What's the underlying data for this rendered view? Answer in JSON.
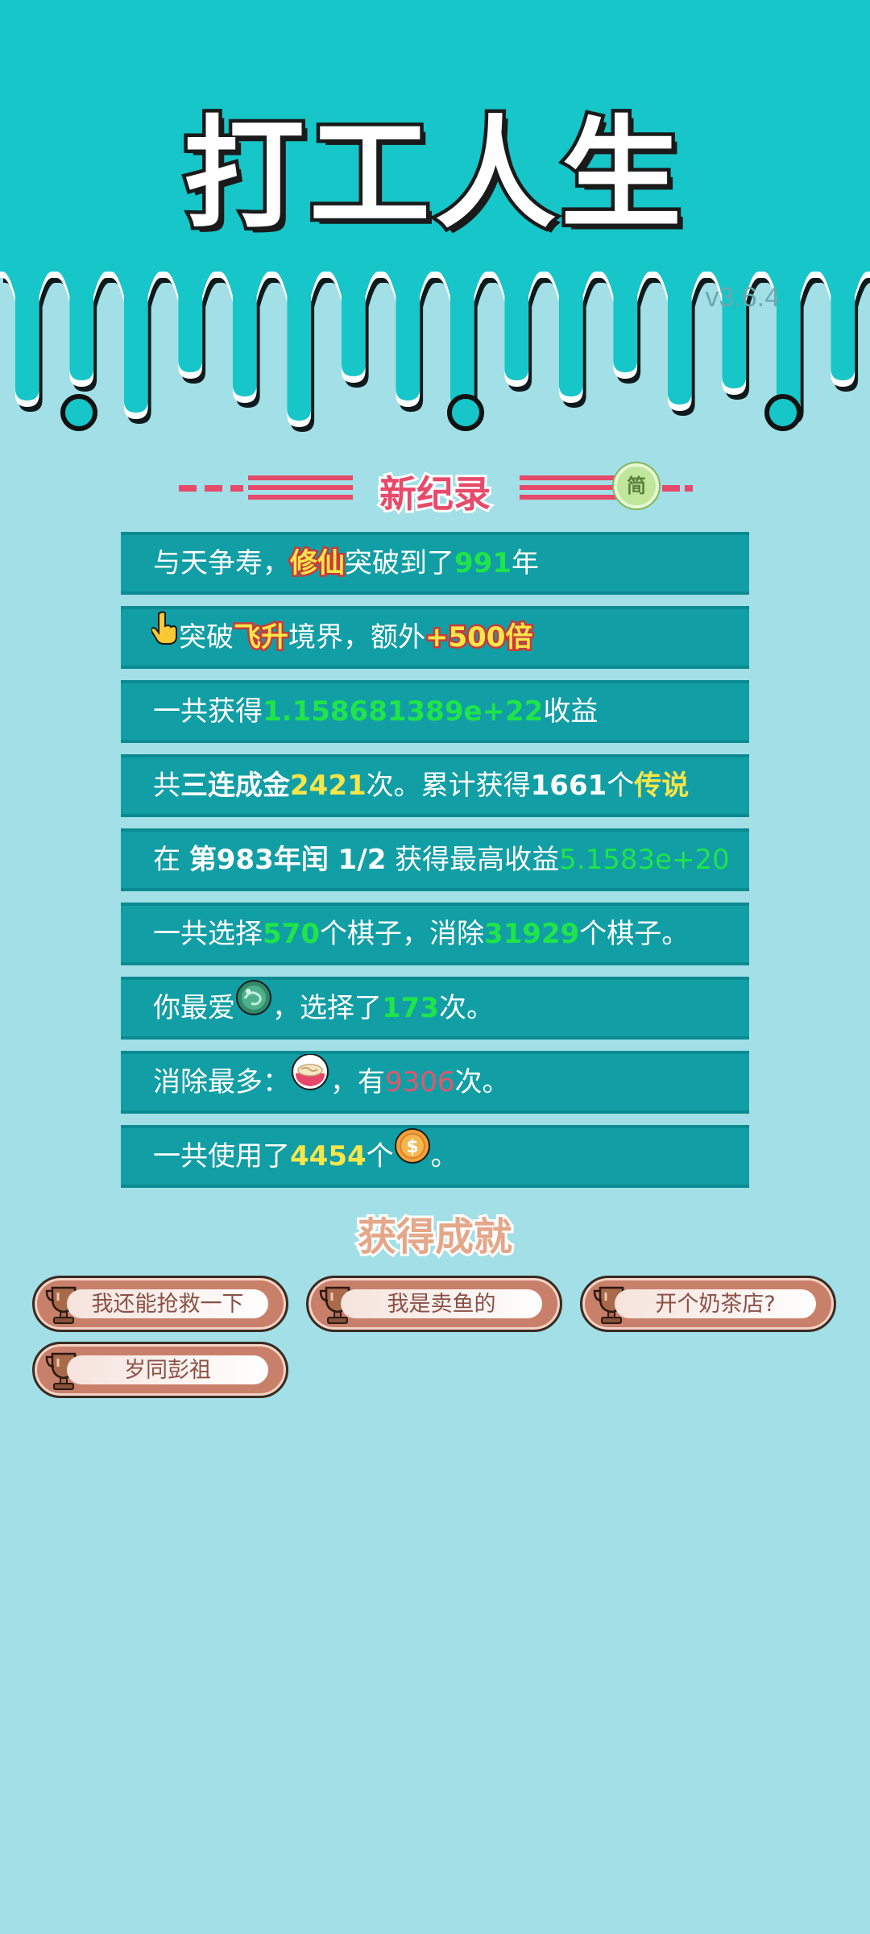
{
  "app": {
    "title": "打工人生",
    "version": "v3.6.4"
  },
  "record": {
    "title": "新纪录",
    "jian_label": "简"
  },
  "stats": {
    "row1": {
      "a": "与天争寿，",
      "tag": "修仙",
      "b": "突破到了",
      "num": "991",
      "c": "年"
    },
    "row2": {
      "a": "突破",
      "tag": "飞升",
      "b": "境界，额外",
      "bonus": "+500倍"
    },
    "row3": {
      "a": "一共获得",
      "num": "1.158681389e+22",
      "b": "收益"
    },
    "row4": {
      "a": "共",
      "combo": "三连成金",
      "num": "2421",
      "b": "次。累计获得",
      "count": "1661",
      "c": "个",
      "rarity": "传说"
    },
    "row5": {
      "a": "在 ",
      "period": "第983年闰 1/2",
      "b": " 获得最高收益",
      "num": "5.1583e+20"
    },
    "row6": {
      "a": "一共选择",
      "num1": "570",
      "b": "个棋子，消除",
      "num2": "31929",
      "c": "个棋子。"
    },
    "row7": {
      "a": "你最爱",
      "b": "，选择了",
      "num": "173",
      "c": "次。"
    },
    "row8": {
      "a": "消除最多：",
      "b": "，有",
      "num": "9306",
      "c": "次。"
    },
    "row9": {
      "a": "一共使用了",
      "num": "4454",
      "b": "个",
      "c": "。"
    }
  },
  "achievements": {
    "title": "获得成就",
    "items": [
      {
        "label": "我还能抢救一下"
      },
      {
        "label": "我是卖鱼的"
      },
      {
        "label": "开个奶茶店?"
      },
      {
        "label": "岁同彭祖"
      }
    ]
  },
  "icons": {
    "hand": "pointing-hand-icon",
    "jade": "jade-orb-icon",
    "bowl": "noodle-bowl-icon",
    "coin": "coin-icon",
    "trophy": "trophy-icon"
  },
  "colors": {
    "header_bg": "#16c6c8",
    "page_bg": "#a2dfe6",
    "row_bg": "#129ea5",
    "accent_green": "#1fe44a",
    "accent_yellow": "#f6e64a",
    "accent_red": "#e4566c"
  }
}
